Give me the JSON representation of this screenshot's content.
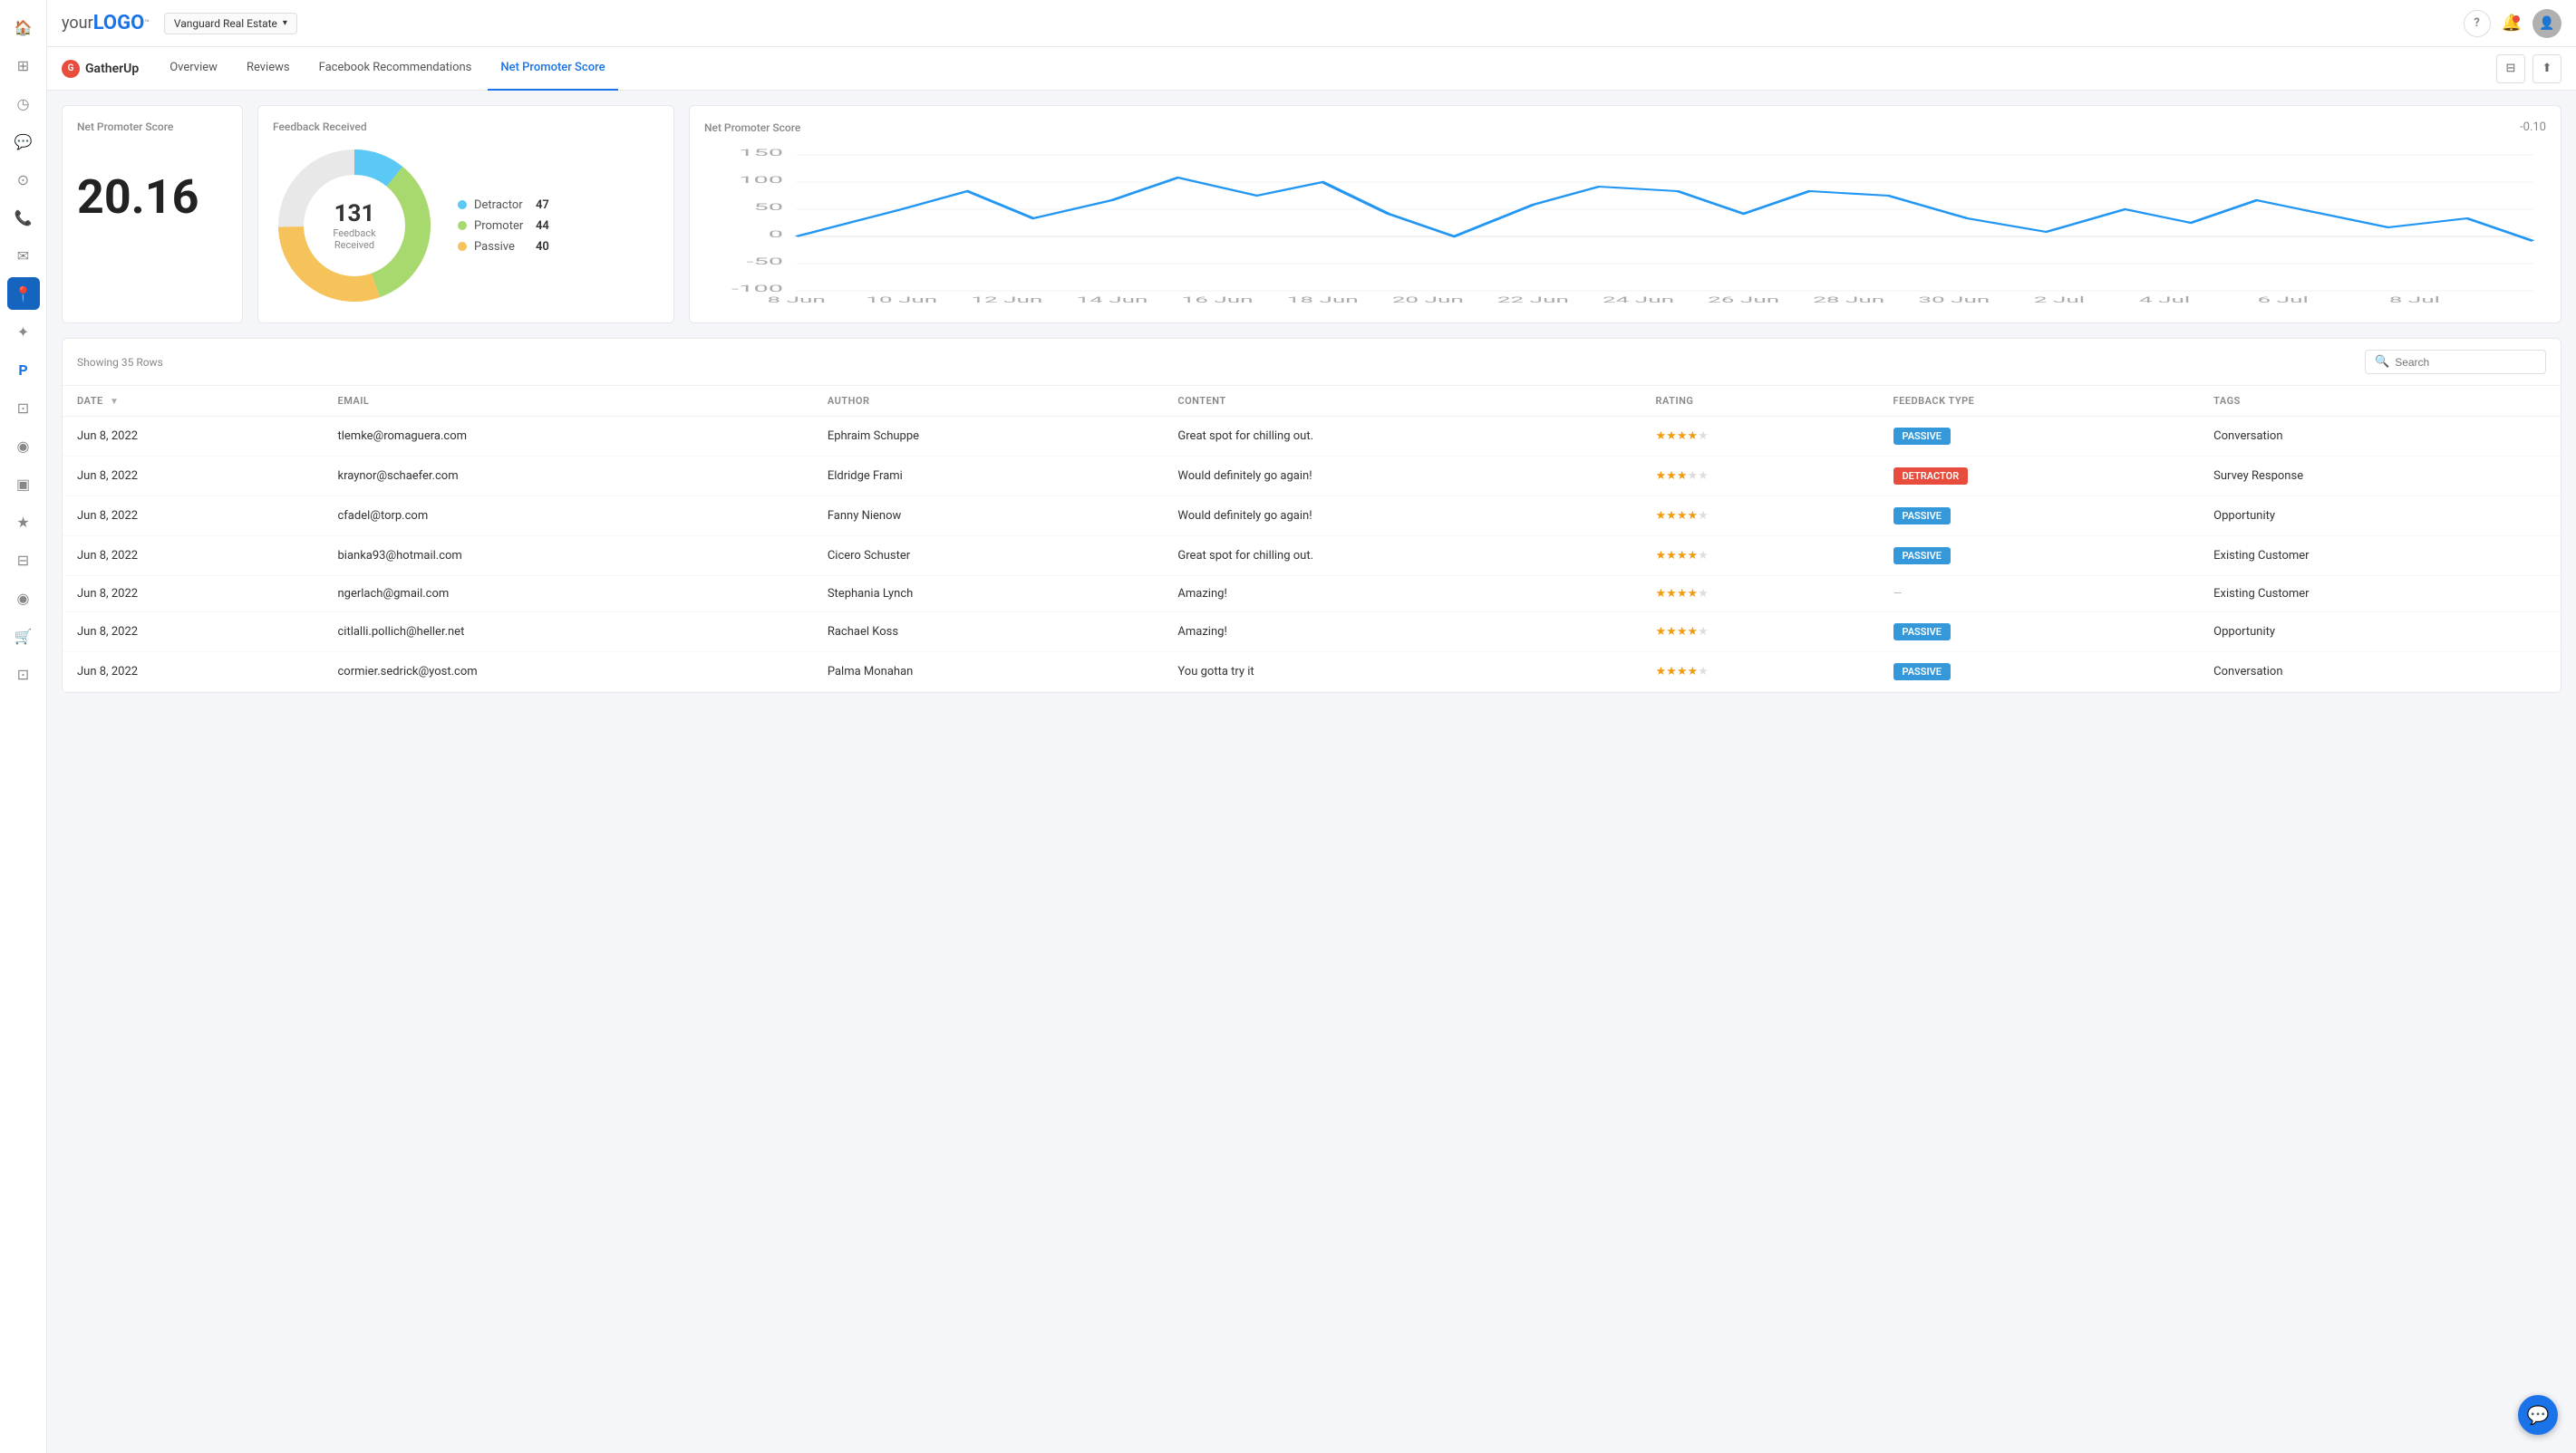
{
  "logo": {
    "text": "your",
    "bold": "LOGO",
    "tm": "™"
  },
  "location": {
    "label": "Vanguard Real Estate"
  },
  "topnav": {
    "help_icon": "?",
    "notif_icon": "🔔"
  },
  "subnav": {
    "brand": "GatherUp",
    "tabs": [
      {
        "id": "overview",
        "label": "Overview",
        "active": false
      },
      {
        "id": "reviews",
        "label": "Reviews",
        "active": false
      },
      {
        "id": "facebook",
        "label": "Facebook Recommendations",
        "active": false
      },
      {
        "id": "nps",
        "label": "Net Promoter Score",
        "active": true
      }
    ]
  },
  "nps_widget": {
    "title": "Net Promoter Score",
    "score": "20.16"
  },
  "feedback_widget": {
    "title": "Feedback Received",
    "total": "131",
    "sub": "Feedback Received",
    "legend": [
      {
        "id": "detractor",
        "label": "Detractor",
        "value": "47",
        "color": "#5bc8f5"
      },
      {
        "id": "promoter",
        "label": "Promoter",
        "value": "44",
        "color": "#a8d96e"
      },
      {
        "id": "passive",
        "label": "Passive",
        "value": "40",
        "color": "#f5c35a"
      }
    ]
  },
  "chart_widget": {
    "title": "Net Promoter Score",
    "value": "-0.10",
    "x_labels": [
      "8 Jun",
      "10 Jun",
      "12 Jun",
      "14 Jun",
      "16 Jun",
      "18 Jun",
      "20 Jun",
      "22 Jun",
      "24 Jun",
      "26 Jun",
      "28 Jun",
      "30 Jun",
      "2 Jul",
      "4 Jul",
      "6 Jul",
      "8 Jul"
    ],
    "y_labels": [
      "150",
      "100",
      "50",
      "0",
      "-50",
      "-100"
    ]
  },
  "table": {
    "showing": "Showing 35 Rows",
    "search_placeholder": "Search",
    "columns": [
      "DATE",
      "EMAIL",
      "AUTHOR",
      "CONTENT",
      "RATING",
      "FEEDBACK TYPE",
      "TAGS"
    ],
    "rows": [
      {
        "date": "Jun 8, 2022",
        "email": "tlemke@romaguera.com",
        "author": "Ephraim Schuppe",
        "content": "Great spot for chilling out.",
        "rating": 4,
        "feedback_type": "PASSIVE",
        "tags": "Conversation"
      },
      {
        "date": "Jun 8, 2022",
        "email": "kraynor@schaefer.com",
        "author": "Eldridge Frami",
        "content": "Would definitely go again!",
        "rating": 3,
        "feedback_type": "DETRACTOR",
        "tags": "Survey Response"
      },
      {
        "date": "Jun 8, 2022",
        "email": "cfadel@torp.com",
        "author": "Fanny Nienow",
        "content": "Would definitely go again!",
        "rating": 4,
        "feedback_type": "PASSIVE",
        "tags": "Opportunity"
      },
      {
        "date": "Jun 8, 2022",
        "email": "bianka93@hotmail.com",
        "author": "Cicero Schuster",
        "content": "Great spot for chilling out.",
        "rating": 4,
        "feedback_type": "PASSIVE",
        "tags": "Existing Customer"
      },
      {
        "date": "Jun 8, 2022",
        "email": "ngerlach@gmail.com",
        "author": "Stephania Lynch",
        "content": "Amazing!",
        "rating": 4,
        "feedback_type": "",
        "tags": "Existing Customer"
      },
      {
        "date": "Jun 8, 2022",
        "email": "citlalli.pollich@heller.net",
        "author": "Rachael Koss",
        "content": "Amazing!",
        "rating": 4,
        "feedback_type": "PASSIVE",
        "tags": "Opportunity"
      },
      {
        "date": "Jun 8, 2022",
        "email": "cormier.sedrick@yost.com",
        "author": "Palma Monahan",
        "content": "You gotta try it",
        "rating": 4,
        "feedback_type": "PASSIVE",
        "tags": "Conversation"
      }
    ]
  },
  "sidebar_icons": [
    "⊞",
    "⊡",
    "◷",
    "💬",
    "⊙",
    "📞",
    "✉",
    "📍",
    "✦",
    "P",
    "⊡",
    "◉",
    "⬛",
    "★",
    "⊟",
    "⊙",
    "🛒",
    "⊡"
  ],
  "chat_icon": "💬"
}
